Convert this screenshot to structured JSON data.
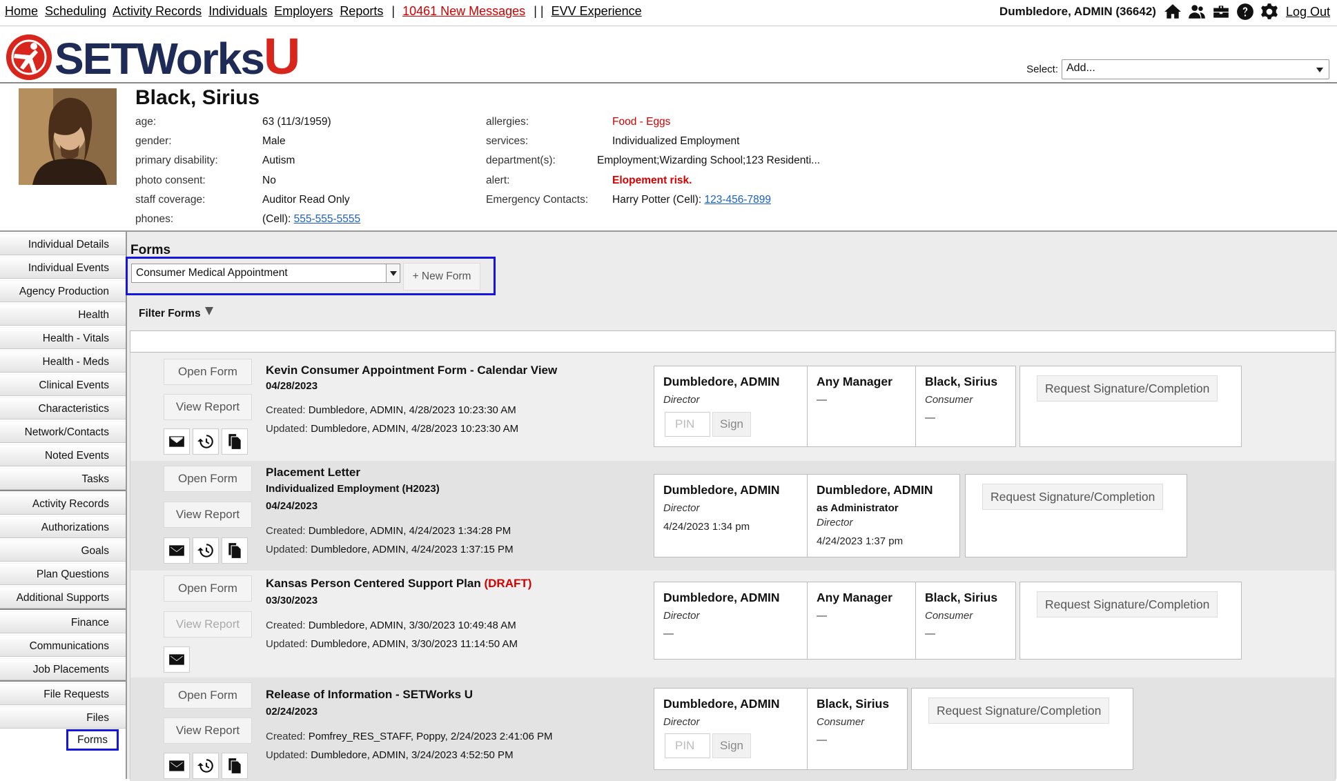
{
  "nav": {
    "links": [
      "Home",
      "Scheduling",
      "Activity Records",
      "Individuals",
      "Employers",
      "Reports"
    ],
    "messages": "10461 New Messages",
    "separator": "| |",
    "evv": "EVV Experience",
    "user": "Dumbledore, ADMIN  (36642)",
    "logout": "Log Out"
  },
  "logo": {
    "text_main": "SETWorks",
    "text_accent": "U"
  },
  "select": {
    "label": "Select:",
    "value": "Add..."
  },
  "individual": {
    "name": "Black, Sirius",
    "left": [
      {
        "label": "age:",
        "value": "63 (11/3/1959)"
      },
      {
        "label": "gender:",
        "value": "Male"
      },
      {
        "label": "primary disability:",
        "value": "Autism"
      },
      {
        "label": "photo consent:",
        "value": "No"
      },
      {
        "label": "staff coverage:",
        "value": "Auditor Read Only"
      },
      {
        "label": "phones:",
        "value_prefix": "(Cell): ",
        "value_link": "555-555-5555"
      }
    ],
    "right": [
      {
        "label": "allergies:",
        "value": "Food - Eggs"
      },
      {
        "label": "services:",
        "value": "Individualized Employment"
      },
      {
        "label": "department(s):",
        "value": "Employment;Wizarding School;123 Residenti..."
      },
      {
        "label": "alert:",
        "value": "Elopement risk."
      },
      {
        "label": "Emergency Contacts:",
        "value_prefix": "Harry Potter (Cell): ",
        "value_link": "123-456-7899"
      }
    ]
  },
  "sidebar": {
    "items": [
      "Individual Details",
      "Individual Events",
      "Agency Production",
      "Health",
      "Health - Vitals",
      "Health - Meds",
      "Clinical Events",
      "Characteristics",
      "Network/Contacts",
      "Noted Events",
      "Tasks",
      "Activity Records",
      "Authorizations",
      "Goals",
      "Plan Questions",
      "Additional Supports",
      "Finance",
      "Communications",
      "Job Placements",
      "File Requests",
      "Files",
      "Forms"
    ]
  },
  "main": {
    "title": "Forms",
    "form_select": "Consumer Medical Appointment",
    "new_form": "+ New Form",
    "filter": "Filter Forms"
  },
  "buttons": {
    "open": "Open Form",
    "view": "View Report",
    "pin": "PIN",
    "sign": "Sign",
    "request": "Request Signature/Completion"
  },
  "forms": [
    {
      "title": "Kevin Consumer Appointment Form - Calendar View",
      "draft": "",
      "subtitle": "",
      "date": "04/28/2023",
      "created_label": "Created:",
      "created": "Dumbledore, ADMIN, 4/28/2023 10:23:30 AM",
      "updated_label": "Updated:",
      "updated": "Dumbledore, ADMIN, 4/28/2023 10:23:30 AM",
      "signers": [
        {
          "name": "Dumbledore, ADMIN",
          "role": "Director",
          "status": "pin"
        },
        {
          "name": "Any Manager",
          "role": "",
          "status": "—"
        },
        {
          "name": "Black, Sirius",
          "role": "Consumer",
          "status": "—"
        }
      ]
    },
    {
      "title": "Placement Letter",
      "draft": "",
      "subtitle": "Individualized Employment (H2023)",
      "date": "04/24/2023",
      "created_label": "Created:",
      "created": "Dumbledore, ADMIN, 4/24/2023 1:34:28 PM",
      "updated_label": "Updated:",
      "updated": "Dumbledore, ADMIN, 4/24/2023 1:37:15 PM",
      "signers": [
        {
          "name": "Dumbledore, ADMIN",
          "role": "Director",
          "status": "4/24/2023 1:34 pm"
        },
        {
          "name": "Dumbledore, ADMIN",
          "as": "as Administrator",
          "role": "Director",
          "status": "4/24/2023 1:37 pm"
        }
      ]
    },
    {
      "title": "Kansas Person Centered Support Plan",
      "draft": "(DRAFT)",
      "subtitle": "",
      "date": "03/30/2023",
      "created_label": "Created:",
      "created": "Dumbledore, ADMIN, 3/30/2023 10:49:48 AM",
      "updated_label": "Updated:",
      "updated": "Dumbledore, ADMIN, 3/30/2023 11:14:50 AM",
      "signers": [
        {
          "name": "Dumbledore, ADMIN",
          "role": "Director",
          "status": "—"
        },
        {
          "name": "Any Manager",
          "role": "",
          "status": "—"
        },
        {
          "name": "Black, Sirius",
          "role": "Consumer",
          "status": "—"
        }
      ]
    },
    {
      "title": "Release of Information - SETWorks U",
      "draft": "",
      "subtitle": "",
      "date": "02/24/2023",
      "created_label": "Created:",
      "created": "Pomfrey_RES_STAFF, Poppy, 2/24/2023 2:41:06 PM",
      "updated_label": "Updated:",
      "updated": "Dumbledore, ADMIN, 3/24/2023 4:52:50 PM",
      "signers": [
        {
          "name": "Dumbledore, ADMIN",
          "role": "Director",
          "status": "pin"
        },
        {
          "name": "Black, Sirius",
          "role": "Consumer",
          "status": "—"
        }
      ]
    }
  ],
  "icons": [
    "home-icon",
    "people-icon",
    "briefcase-icon",
    "help-icon",
    "gear-icon",
    "email-icon",
    "history-icon",
    "copy-icon"
  ],
  "colors": {
    "brand_red": "#d9261c",
    "brand_navy": "#1d2b56",
    "highlight": "#1515e0",
    "alert_red": "#d40000",
    "link": "#1a5fc7"
  }
}
